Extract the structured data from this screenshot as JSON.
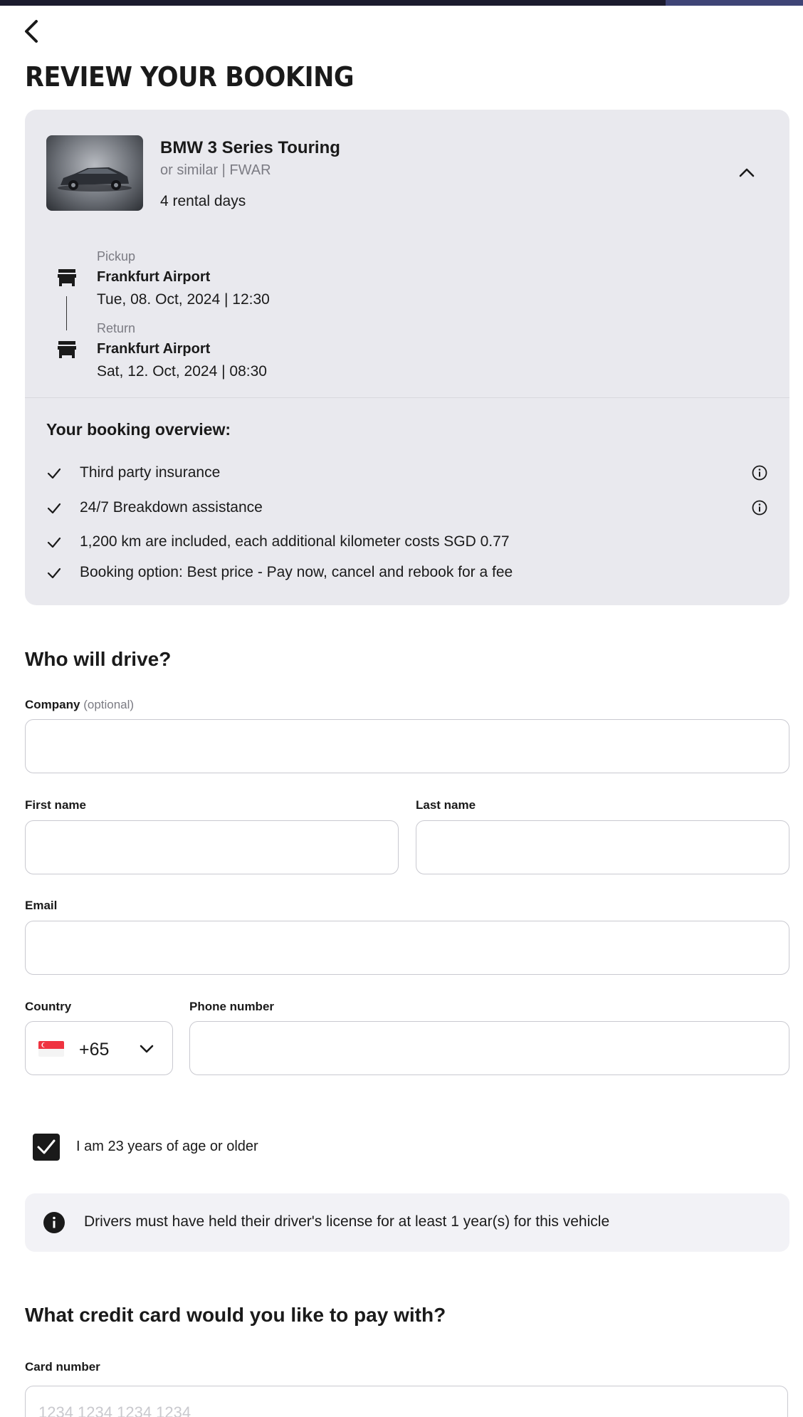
{
  "header": {
    "title": "REVIEW YOUR BOOKING"
  },
  "vehicle": {
    "name": "BMW 3 Series Touring",
    "subtitle": "or similar | FWAR",
    "rental_days": "4 rental days"
  },
  "pickup": {
    "label": "Pickup",
    "location": "Frankfurt Airport",
    "datetime": "Tue, 08. Oct, 2024 | 12:30"
  },
  "return": {
    "label": "Return",
    "location": "Frankfurt Airport",
    "datetime": "Sat, 12. Oct, 2024 | 08:30"
  },
  "overview": {
    "title": "Your booking overview:",
    "items": [
      {
        "text": "Third party insurance"
      },
      {
        "text": "24/7 Breakdown assistance"
      },
      {
        "text": "1,200 km are included, each additional kilometer costs SGD 0.77"
      },
      {
        "text": "Booking option: Best price - Pay now, cancel and rebook for a fee"
      }
    ]
  },
  "driver": {
    "title": "Who will drive?",
    "company_label": "Company",
    "company_optional": "(optional)",
    "company_value": "",
    "first_name_label": "First name",
    "first_name_value": "",
    "last_name_label": "Last name",
    "last_name_value": "",
    "email_label": "Email",
    "email_value": "",
    "country_label": "Country",
    "country_code": "+65",
    "phone_label": "Phone number",
    "phone_value": "",
    "age_checkbox_label": "I am 23 years of age or older",
    "age_checked": true,
    "license_notice": "Drivers must have held their driver's license for at least 1 year(s) for this vehicle"
  },
  "payment": {
    "title": "What credit card would you like to pay with?",
    "card_number_label": "Card number",
    "card_number_placeholder": "1234 1234 1234 1234"
  },
  "icons": {
    "back": "chevron-left-icon",
    "collapse": "chevron-up-icon",
    "location": "store-icon",
    "check": "check-icon",
    "info": "info-circle-icon",
    "dropdown": "chevron-down-icon",
    "flag": "singapore-flag-icon"
  },
  "colors": {
    "card_background": "#e9e9ee",
    "notice_background": "#f2f2f6",
    "top_bar": "#1c1b2e",
    "checkbox": "#1a1a1a",
    "flag_red": "#ef3340"
  }
}
